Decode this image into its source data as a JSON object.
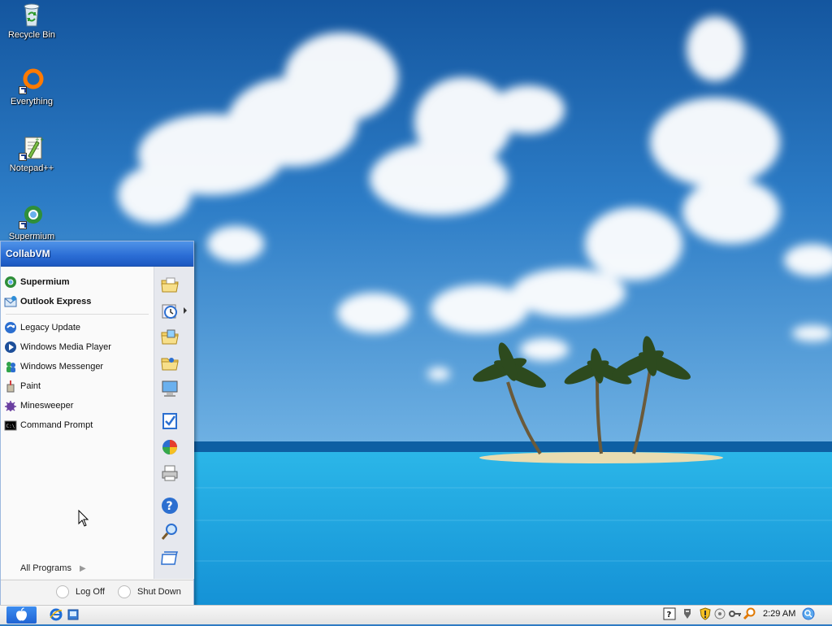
{
  "desktop": {
    "icons": [
      {
        "label": "Recycle Bin",
        "icon": "recycle-bin-icon"
      },
      {
        "label": "Everything",
        "icon": "everything-icon"
      },
      {
        "label": "Notepad++",
        "icon": "notepad-plus-plus-icon"
      },
      {
        "label": "Supermium",
        "icon": "supermium-icon"
      }
    ]
  },
  "start_menu": {
    "user_name": "CollabVM",
    "pinned": [
      {
        "label": "Supermium",
        "icon": "supermium-icon"
      },
      {
        "label": "Outlook Express",
        "icon": "outlook-express-icon"
      }
    ],
    "recent": [
      {
        "label": "Legacy Update",
        "icon": "legacy-update-icon"
      },
      {
        "label": "Windows Media Player",
        "icon": "media-player-icon"
      },
      {
        "label": "Windows Messenger",
        "icon": "messenger-icon"
      },
      {
        "label": "Paint",
        "icon": "paint-icon"
      },
      {
        "label": "Minesweeper",
        "icon": "minesweeper-icon"
      },
      {
        "label": "Command Prompt",
        "icon": "command-prompt-icon"
      }
    ],
    "all_programs": "All Programs",
    "right_icons": [
      "my-documents-icon",
      "recent-documents-icon",
      "my-pictures-icon",
      "my-music-icon",
      "my-computer-icon",
      "control-panel-icon",
      "set-program-defaults-icon",
      "printers-icon",
      "help-icon",
      "search-icon",
      "run-icon"
    ],
    "log_off": "Log Off",
    "shut_down": "Shut Down"
  },
  "taskbar": {
    "start_icon": "apple-logo-icon",
    "quick_launch": [
      "internet-explorer-icon",
      "show-desktop-icon"
    ],
    "tray_icons": [
      "help-tray-icon",
      "network-tray-icon",
      "security-shield-icon",
      "update-tray-icon",
      "key-icon",
      "magnifier-tray-icon"
    ],
    "clock": "2:29 AM",
    "search_icon": "search-globe-icon"
  },
  "colors": {
    "start_header": "#2a6cd4",
    "taskbar": "#ececec",
    "sky": "#2f7bc4",
    "sea": "#1fa6df"
  }
}
